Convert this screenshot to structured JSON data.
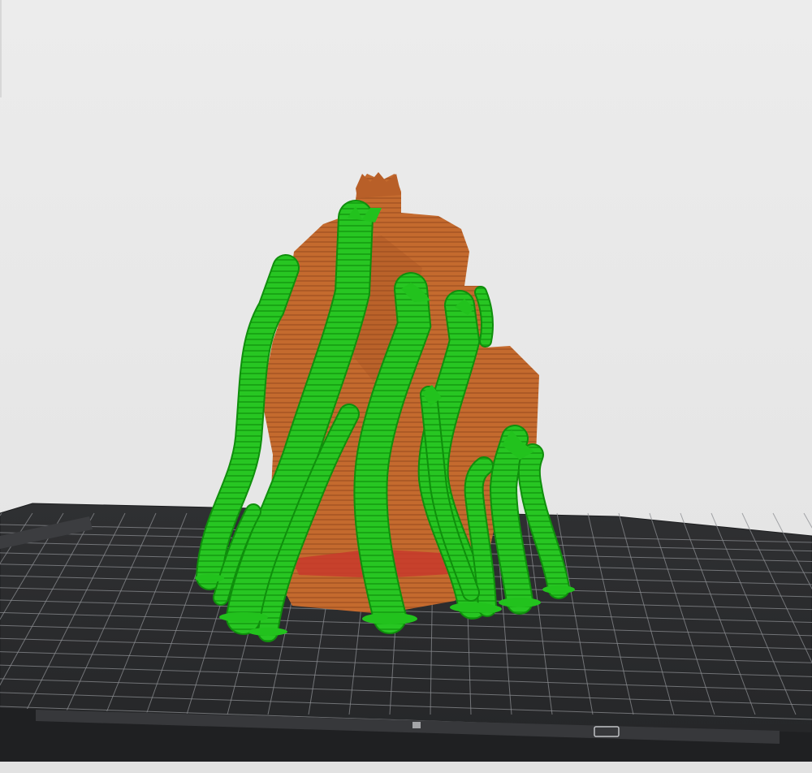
{
  "viewport": {
    "background_color": "#e9e9e9",
    "build_plate": {
      "surface_color": "#2b2c2e",
      "grid_line_color": "#8a8c90",
      "border_color": "#1d1e20",
      "rim_highlight_color": "#bfc1c4"
    },
    "model": {
      "body_color": "#c46a2e",
      "body_shadow_color": "#9a4d1f",
      "base_accent_color": "#c83a2c",
      "support_color": "#22c21d",
      "support_shadow_color": "#0f8f0c"
    }
  }
}
